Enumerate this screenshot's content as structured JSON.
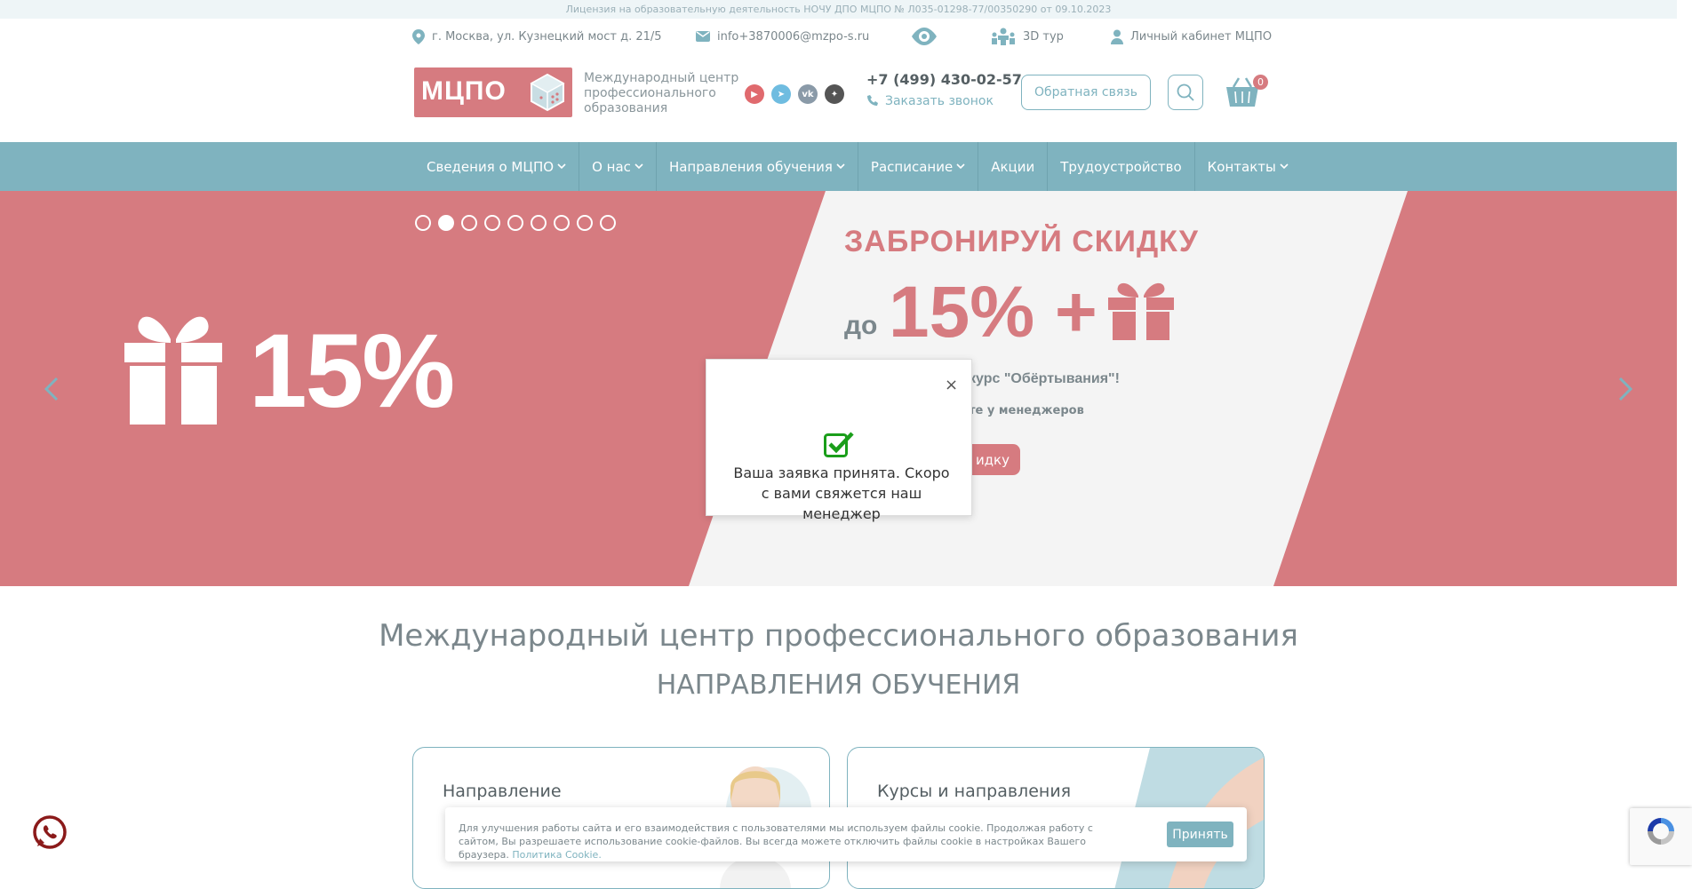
{
  "license": "Лицензия на образовательную деятельность НОЧУ ДПО МЦПО № Л035-01298-77/00350290 от 09.10.2023",
  "header": {
    "address": "г. Москва, ул. Кузнецкий мост д. 21/5",
    "email": "info+3870006@mzpo-s.ru",
    "tour": "3D тур",
    "cabinet": "Личный кабинет МЦПО",
    "logo_text": "МЦПО",
    "logo_sub": "Международный центр профессионального образования",
    "phone": "+7 (499) 430-02-57",
    "callback": "Заказать звонок",
    "feedback": "Обратная связь",
    "cart_count": "0"
  },
  "nav": {
    "items": [
      {
        "label": "Сведения о МЦПО",
        "dropdown": true
      },
      {
        "label": "О нас",
        "dropdown": true
      },
      {
        "label": "Направления обучения",
        "dropdown": true
      },
      {
        "label": "Расписание",
        "dropdown": true
      },
      {
        "label": "Акции",
        "dropdown": false
      },
      {
        "label": "Трудоустройство",
        "dropdown": false
      },
      {
        "label": "Контакты",
        "dropdown": true
      }
    ]
  },
  "slider": {
    "dot_count": 9,
    "active_dot": 2,
    "big_percent": "15%",
    "title": "ЗАБРОНИРУЙ СКИДКУ",
    "do": "до",
    "percent": "15% +",
    "course": "курс \"Обёртывания\"!",
    "hint": "те у менеджеров",
    "button": "идку"
  },
  "modal": {
    "close": "×",
    "message": "Ваша заявка принята. Скоро с вами свяжется наш менеджер"
  },
  "main": {
    "heading": "Международный центр профессионального образования",
    "subheading": "НАПРАВЛЕНИЯ ОБУЧЕНИЯ",
    "cards": [
      {
        "title": "Направление"
      },
      {
        "title": "Курсы и направления"
      }
    ]
  },
  "cookie": {
    "text": "Для улучшения работы сайта и его взаимодействия с пользователями мы используем файлы cookie. Продолжая работу с сайтом, Вы разрешаете использование cookie-файлов. Вы всегда можете отключить файлы cookie в настройках Вашего браузера.",
    "link": "Политика Cookie.",
    "accept": "Принять"
  },
  "colors": {
    "accent": "#7fb3bf",
    "brand": "#d67b80"
  }
}
